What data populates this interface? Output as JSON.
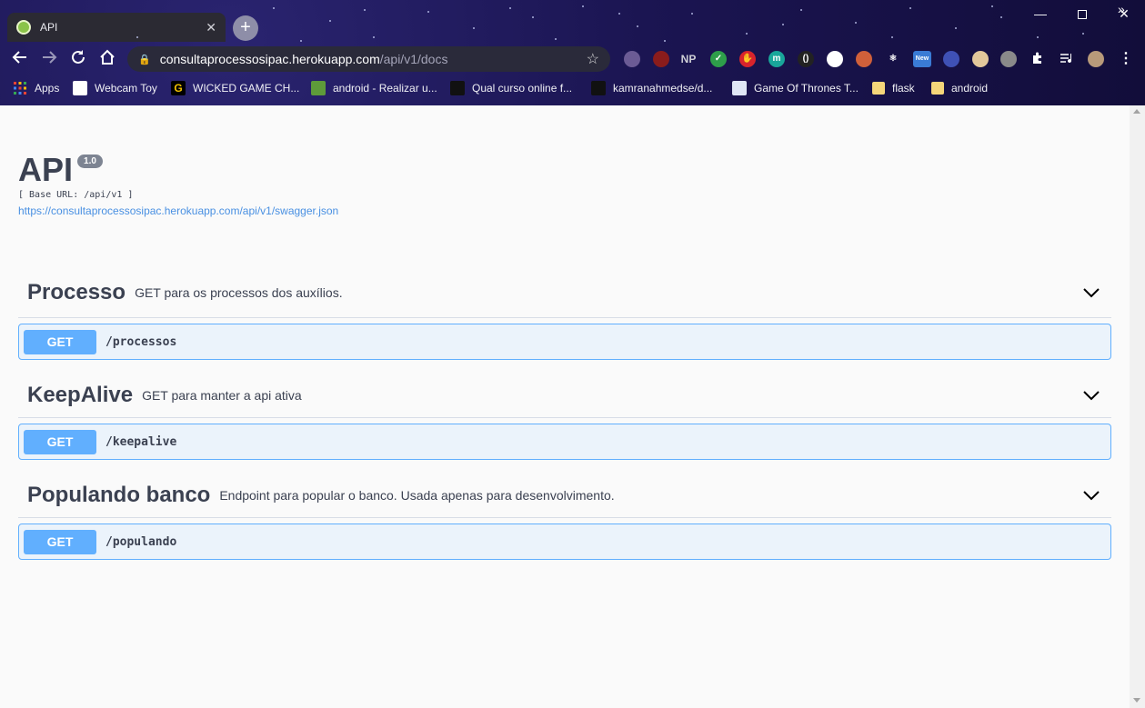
{
  "browser": {
    "tab_title": "API",
    "url_domain": "consultaprocessosipac.herokuapp.com",
    "url_path": "/api/v1/docs",
    "new_tab_glyph": "+",
    "bookmarks": [
      {
        "label": "Apps",
        "icon": "apps-grid-icon",
        "color": "#e94235"
      },
      {
        "label": "Webcam Toy",
        "icon": "webcam-toy-icon",
        "color": "#ffffff"
      },
      {
        "label": "WICKED GAME CH...",
        "icon": "wicked-game-icon",
        "color": "#000000"
      },
      {
        "label": "android - Realizar u...",
        "icon": "stackoverflow-icon",
        "color": "#5e9b3a"
      },
      {
        "label": "Qual curso online f...",
        "icon": "github-icon",
        "color": "#111111"
      },
      {
        "label": "kamranahmedse/d...",
        "icon": "github-icon",
        "color": "#111111"
      },
      {
        "label": "Game Of Thrones T...",
        "icon": "translate-icon",
        "color": "#dfe6f5"
      },
      {
        "label": "flask",
        "icon": "folder-icon",
        "color": "#f5d67a"
      },
      {
        "label": "android",
        "icon": "folder-icon",
        "color": "#f5d67a"
      }
    ],
    "extensions": [
      {
        "name": "purple-orb-icon",
        "color": "#6b5b95",
        "glyph": ""
      },
      {
        "name": "chat-extension-icon",
        "color": "#8a1c1c",
        "glyph": ""
      },
      {
        "name": "np-extension-icon",
        "color": "transparent",
        "glyph": "NP"
      },
      {
        "name": "shield-check-icon",
        "color": "#2e9e4a",
        "glyph": "✓"
      },
      {
        "name": "stop-hand-icon",
        "color": "#d8242c",
        "glyph": "✋"
      },
      {
        "name": "m-extension-icon",
        "color": "#19a69a",
        "glyph": "m"
      },
      {
        "name": "bracket-extension-icon",
        "color": "#222222",
        "glyph": "()"
      },
      {
        "name": "clock-extension-icon",
        "color": "#ffffff",
        "glyph": ""
      },
      {
        "name": "avatar-extension-icon",
        "color": "#d0603a",
        "glyph": ""
      },
      {
        "name": "react-extension-icon",
        "color": "transparent",
        "glyph": "⚛"
      },
      {
        "name": "new-extension-icon",
        "color": "#3a7bd5",
        "glyph": "New"
      },
      {
        "name": "circle-extension-icon",
        "color": "#3f51b5",
        "glyph": ""
      },
      {
        "name": "face-extension-icon",
        "color": "#e2c79b",
        "glyph": ""
      },
      {
        "name": "drive-extension-icon",
        "color": "#8a8a8a",
        "glyph": ""
      },
      {
        "name": "puzzle-icon",
        "color": "transparent",
        "glyph": ""
      },
      {
        "name": "media-queue-icon",
        "color": "transparent",
        "glyph": ""
      },
      {
        "name": "profile-avatar-icon",
        "color": "#b89a7a",
        "glyph": ""
      }
    ]
  },
  "api": {
    "title": "API",
    "version": "1.0",
    "base_url": "[ Base URL: /api/v1 ]",
    "spec_url": "https://consultaprocessosipac.herokuapp.com/api/v1/swagger.json"
  },
  "tags": [
    {
      "name": "Processo",
      "description": "GET para os processos dos auxílios.",
      "method": "GET",
      "path": "/processos"
    },
    {
      "name": "KeepAlive",
      "description": "GET para manter a api ativa",
      "method": "GET",
      "path": "/keepalive"
    },
    {
      "name": "Populando banco",
      "description": "Endpoint para popular o banco. Usada apenas para desenvolvimento.",
      "method": "GET",
      "path": "/populando"
    }
  ],
  "colors": {
    "get_method": "#61affe",
    "op_background": "#ebf3fb",
    "text": "#3b4151",
    "link": "#4990e2"
  }
}
